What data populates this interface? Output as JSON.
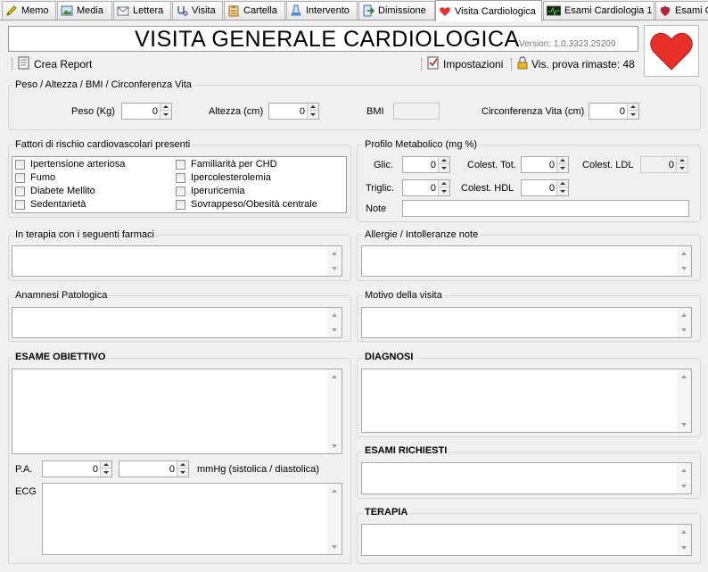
{
  "tabs": [
    {
      "label": "Memo",
      "icon": "pencil-icon"
    },
    {
      "label": "Media",
      "icon": "image-icon"
    },
    {
      "label": "Lettera",
      "icon": "envelope-icon"
    },
    {
      "label": "Visita",
      "icon": "stethoscope-icon"
    },
    {
      "label": "Cartella",
      "icon": "clipboard-icon"
    },
    {
      "label": "Intervento",
      "icon": "flask-icon"
    },
    {
      "label": "Dimissione",
      "icon": "exit-icon"
    },
    {
      "label": "Visita Cardiologica",
      "icon": "heart-icon"
    },
    {
      "label": "Esami Cardiologia 1",
      "icon": "ecg-icon"
    },
    {
      "label": "Esami C",
      "icon": "heart-organ-icon"
    }
  ],
  "header": {
    "title": "VISITA GENERALE CARDIOLOGICA",
    "version": "Version: 1.0.3323.25209",
    "crea_report": "Crea Report",
    "impostazioni": "Impostazioni",
    "trial": "Vis. prova rimaste: 48",
    "accent_color": "#e8302a"
  },
  "biometrics": {
    "title": "Peso / Altezza / BMI / Circonferenza Vita",
    "peso_label": "Peso (Kg)",
    "peso": "0",
    "altezza_label": "Altezza (cm)",
    "altezza": "0",
    "bmi_label": "BMI",
    "bmi": "",
    "vita_label": "Circonferenza Vita (cm)",
    "vita": "0"
  },
  "risk": {
    "title": "Fattori di rischio cardiovascolari presenti",
    "items": [
      "Ipertensione arteriosa",
      "Familiarità per CHD",
      "Fumo",
      "Ipercolesterolemia",
      "Diabete Mellito",
      "Iperuricemia",
      "Sedentarietà",
      "Sovrappeso/Obesità centrale"
    ]
  },
  "metabolic": {
    "title": "Profilo Metabolico (mg %)",
    "glic_label": "Glic.",
    "glic": "0",
    "col_tot_label": "Colest. Tot.",
    "col_tot": "0",
    "ldl_label": "Colest. LDL",
    "ldl": "0",
    "trigl_label": "Triglic.",
    "trigl": "0",
    "hdl_label": "Colest. HDL",
    "hdl": "0",
    "note_label": "Note",
    "note": ""
  },
  "sections": {
    "farmaci": "In terapia con i seguenti farmaci",
    "allergie": "Allergie / Intolleranze note",
    "anamnesi": "Anamnesi Patologica",
    "motivo": "Motivo della visita",
    "esame": "ESAME OBIETTIVO",
    "diagnosi": "DIAGNOSI",
    "esami_richiesti": "ESAMI RICHIESTI",
    "terapia": "TERAPIA"
  },
  "pressure": {
    "pa_label": "P.A.",
    "sistolica": "0",
    "diastolica": "0",
    "unit": "mmHg (sistolica / diastolica)",
    "ecg_label": "ECG"
  }
}
